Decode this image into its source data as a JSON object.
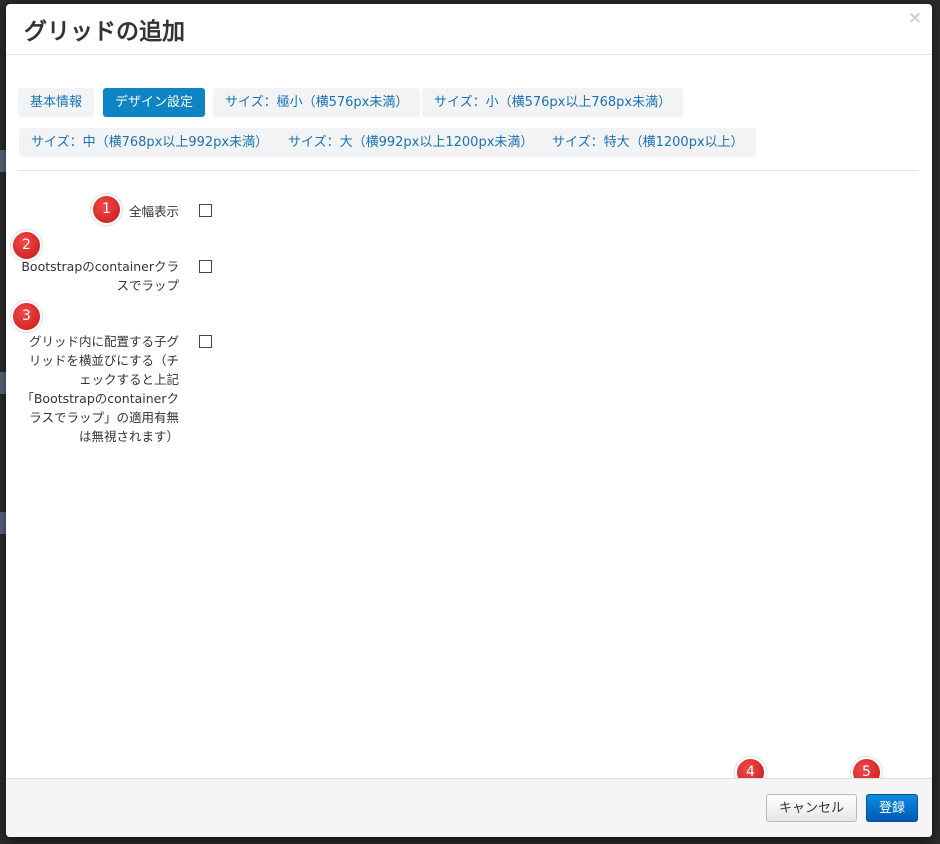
{
  "dialog": {
    "title": "グリッドの追加",
    "close_symbol": "×"
  },
  "tabs": [
    {
      "label": "基本情報",
      "active": false
    },
    {
      "label": "デザイン設定",
      "active": true
    },
    {
      "label": "サイズ：極小（横576px未満）",
      "active": false
    },
    {
      "label": "サイズ：小（横576px以上768px未満）",
      "active": false
    },
    {
      "label": "サイズ：中（横768px以上992px未満）",
      "active": false
    },
    {
      "label": "サイズ：大（横992px以上1200px未満）",
      "active": false
    },
    {
      "label": "サイズ：特大（横1200px以上）",
      "active": false
    }
  ],
  "options": [
    {
      "label": "全幅表示",
      "checked": false
    },
    {
      "label": "Bootstrapのcontainerクラスでラップ",
      "checked": false
    },
    {
      "label": "グリッド内に配置する子グリッドを横並びにする（チェックすると上記「Bootstrapのcontainerクラスでラップ」の適用有無は無視されます）",
      "checked": false
    }
  ],
  "markers": [
    "1",
    "2",
    "3",
    "4",
    "5"
  ],
  "footer": {
    "cancel_label": "キャンセル",
    "submit_label": "登録"
  },
  "colors": {
    "active_tab": "#0e84c4",
    "tab_text": "#1a73b5",
    "marker": "#d92222",
    "submit_button": "#0a6fcc"
  }
}
